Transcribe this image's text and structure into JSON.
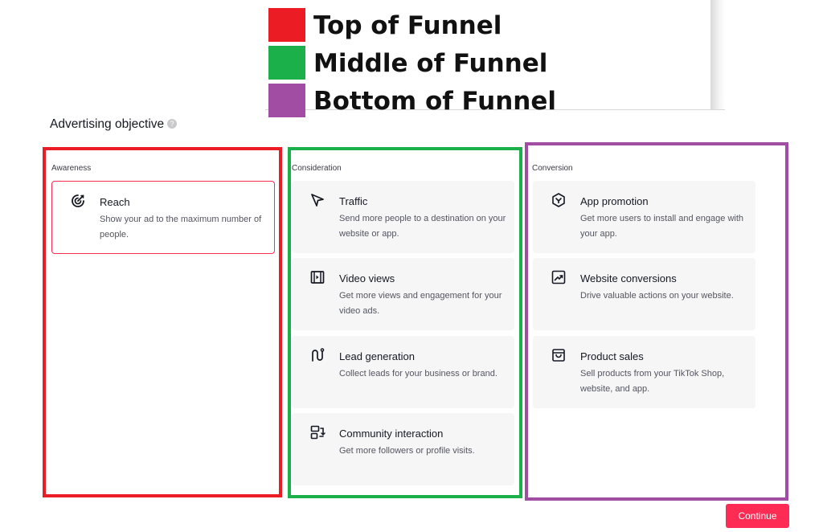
{
  "legend": {
    "items": [
      {
        "label": "Top of Funnel",
        "color": "#ec1c24"
      },
      {
        "label": "Middle of Funnel",
        "color": "#1cb04a"
      },
      {
        "label": "Bottom of Funnel",
        "color": "#a14da4"
      }
    ]
  },
  "section": {
    "title": "Advertising objective",
    "info_icon": "info-icon"
  },
  "columns": [
    {
      "label": "Awareness",
      "border_color": "#ec1c24",
      "cards": [
        {
          "icon": "reach-icon",
          "title": "Reach",
          "description": "Show your ad to the maximum number of people.",
          "selected": true
        }
      ]
    },
    {
      "label": "Consideration",
      "border_color": "#1cb04a",
      "cards": [
        {
          "icon": "traffic-cursor-icon",
          "title": "Traffic",
          "description": "Send more people to a destination on your website or app."
        },
        {
          "icon": "video-views-icon",
          "title": "Video views",
          "description": "Get more views and engagement for your video ads."
        },
        {
          "icon": "lead-generation-icon",
          "title": "Lead generation",
          "description": "Collect leads for your business or brand."
        },
        {
          "icon": "community-interaction-icon",
          "title": "Community interaction",
          "description": "Get more followers or profile visits."
        }
      ]
    },
    {
      "label": "Conversion",
      "border_color": "#a14da4",
      "cards": [
        {
          "icon": "app-promotion-icon",
          "title": "App promotion",
          "description": "Get more users to install and engage with your app."
        },
        {
          "icon": "website-conversions-icon",
          "title": "Website conversions",
          "description": "Drive valuable actions on your website."
        },
        {
          "icon": "product-sales-icon",
          "title": "Product sales",
          "description": "Sell products from your TikTok Shop, website, and app."
        }
      ]
    }
  ],
  "footer": {
    "continue_label": "Continue",
    "accent": "#fe2c55"
  }
}
